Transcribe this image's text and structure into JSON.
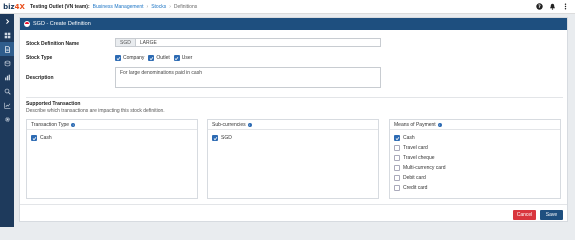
{
  "topbar": {
    "logo_main": "biz",
    "logo_accent": "4X",
    "outlet": "Testing Outlet (VN team):",
    "crumbs": [
      "Business Management",
      "Stocks",
      "Definitions"
    ],
    "icons": [
      "help-icon",
      "bell-icon",
      "more-icon"
    ]
  },
  "sidebar": {
    "icons": [
      "chevron-right-icon",
      "dashboard-icon",
      "document-icon",
      "coins-icon",
      "chart-bars-icon",
      "search-doc-icon",
      "line-chart-icon",
      "settings-icon"
    ]
  },
  "panel": {
    "title": "SGD - Create Definition",
    "stock_name_label": "Stock Definition Name",
    "stock_name_prefix": "SGD",
    "stock_name_value": "LARGE",
    "stock_type_label": "Stock Type",
    "stock_types": [
      {
        "label": "Company",
        "checked": true
      },
      {
        "label": "Outlet",
        "checked": true
      },
      {
        "label": "User",
        "checked": true
      }
    ],
    "description_label": "Description",
    "description_value": "For large denominations paid in cash",
    "supported_title": "Supported Transaction",
    "supported_desc": "Describe which transactions are impacting this stock definition.",
    "transaction_type": {
      "header": "Transaction Type",
      "items": [
        {
          "label": "Cash",
          "checked": true
        }
      ]
    },
    "sub_currencies": {
      "header": "Sub-currencies",
      "items": [
        {
          "label": "SGD",
          "checked": true
        }
      ]
    },
    "means_of_payment": {
      "header": "Means of Payment",
      "items": [
        {
          "label": "Cash",
          "checked": true
        },
        {
          "label": "Travel card",
          "checked": false
        },
        {
          "label": "Travel cheque",
          "checked": false
        },
        {
          "label": "Multi-currency card",
          "checked": false
        },
        {
          "label": "Debit card",
          "checked": false
        },
        {
          "label": "Credit card",
          "checked": false
        }
      ]
    },
    "cancel_label": "Cancel",
    "save_label": "Save"
  },
  "colors": {
    "primary": "#1e4f7f",
    "sidebar": "#1e3a5c",
    "danger": "#d9363e",
    "checkbox": "#2d6bb3"
  }
}
